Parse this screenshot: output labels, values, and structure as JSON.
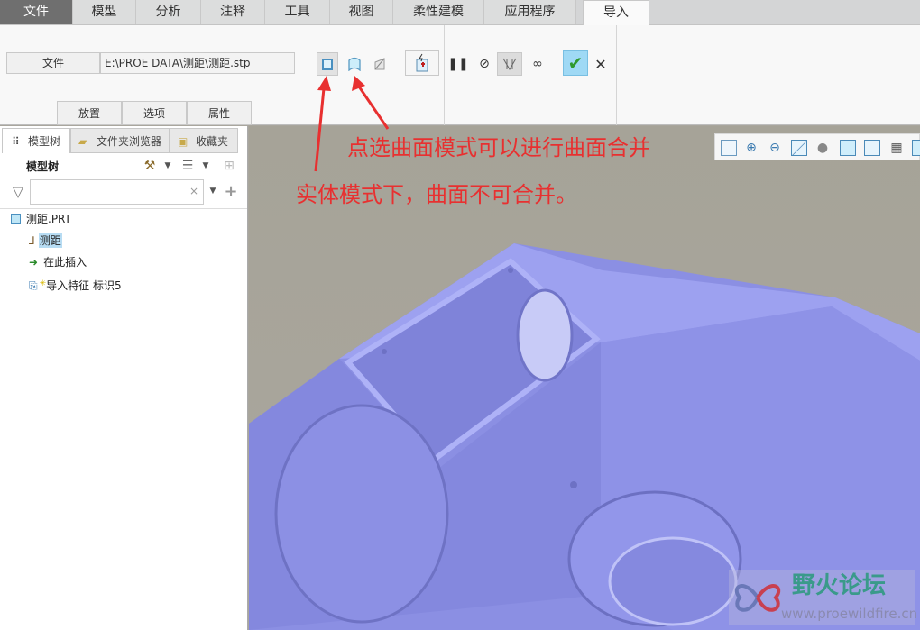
{
  "tabs": [
    "文件",
    "模型",
    "分析",
    "注释",
    "工具",
    "视图",
    "柔性建模",
    "应用程序",
    "导入"
  ],
  "ribbon": {
    "file_label": "文件",
    "file_path": "E:\\PROE DATA\\测距\\测距.stp",
    "subtabs": [
      "放置",
      "选项",
      "属性"
    ]
  },
  "panel": {
    "tabs": [
      "模型树",
      "文件夹浏览器",
      "收藏夹"
    ],
    "header": "模型树",
    "search_placeholder": "",
    "clear": "×",
    "tree": [
      "测距.PRT",
      "测距",
      "在此插入",
      "导入特征 标识5"
    ]
  },
  "annotations": {
    "surface": "点选曲面模式可以进行曲面合并",
    "solid": "实体模式下，曲面不可合并。"
  },
  "watermark": {
    "name": "野火论坛",
    "url": "www.proewildfire.cn"
  },
  "colors": {
    "model": "#8f93e6",
    "annotation": "#e83030",
    "accent": "#9fd9f5"
  }
}
